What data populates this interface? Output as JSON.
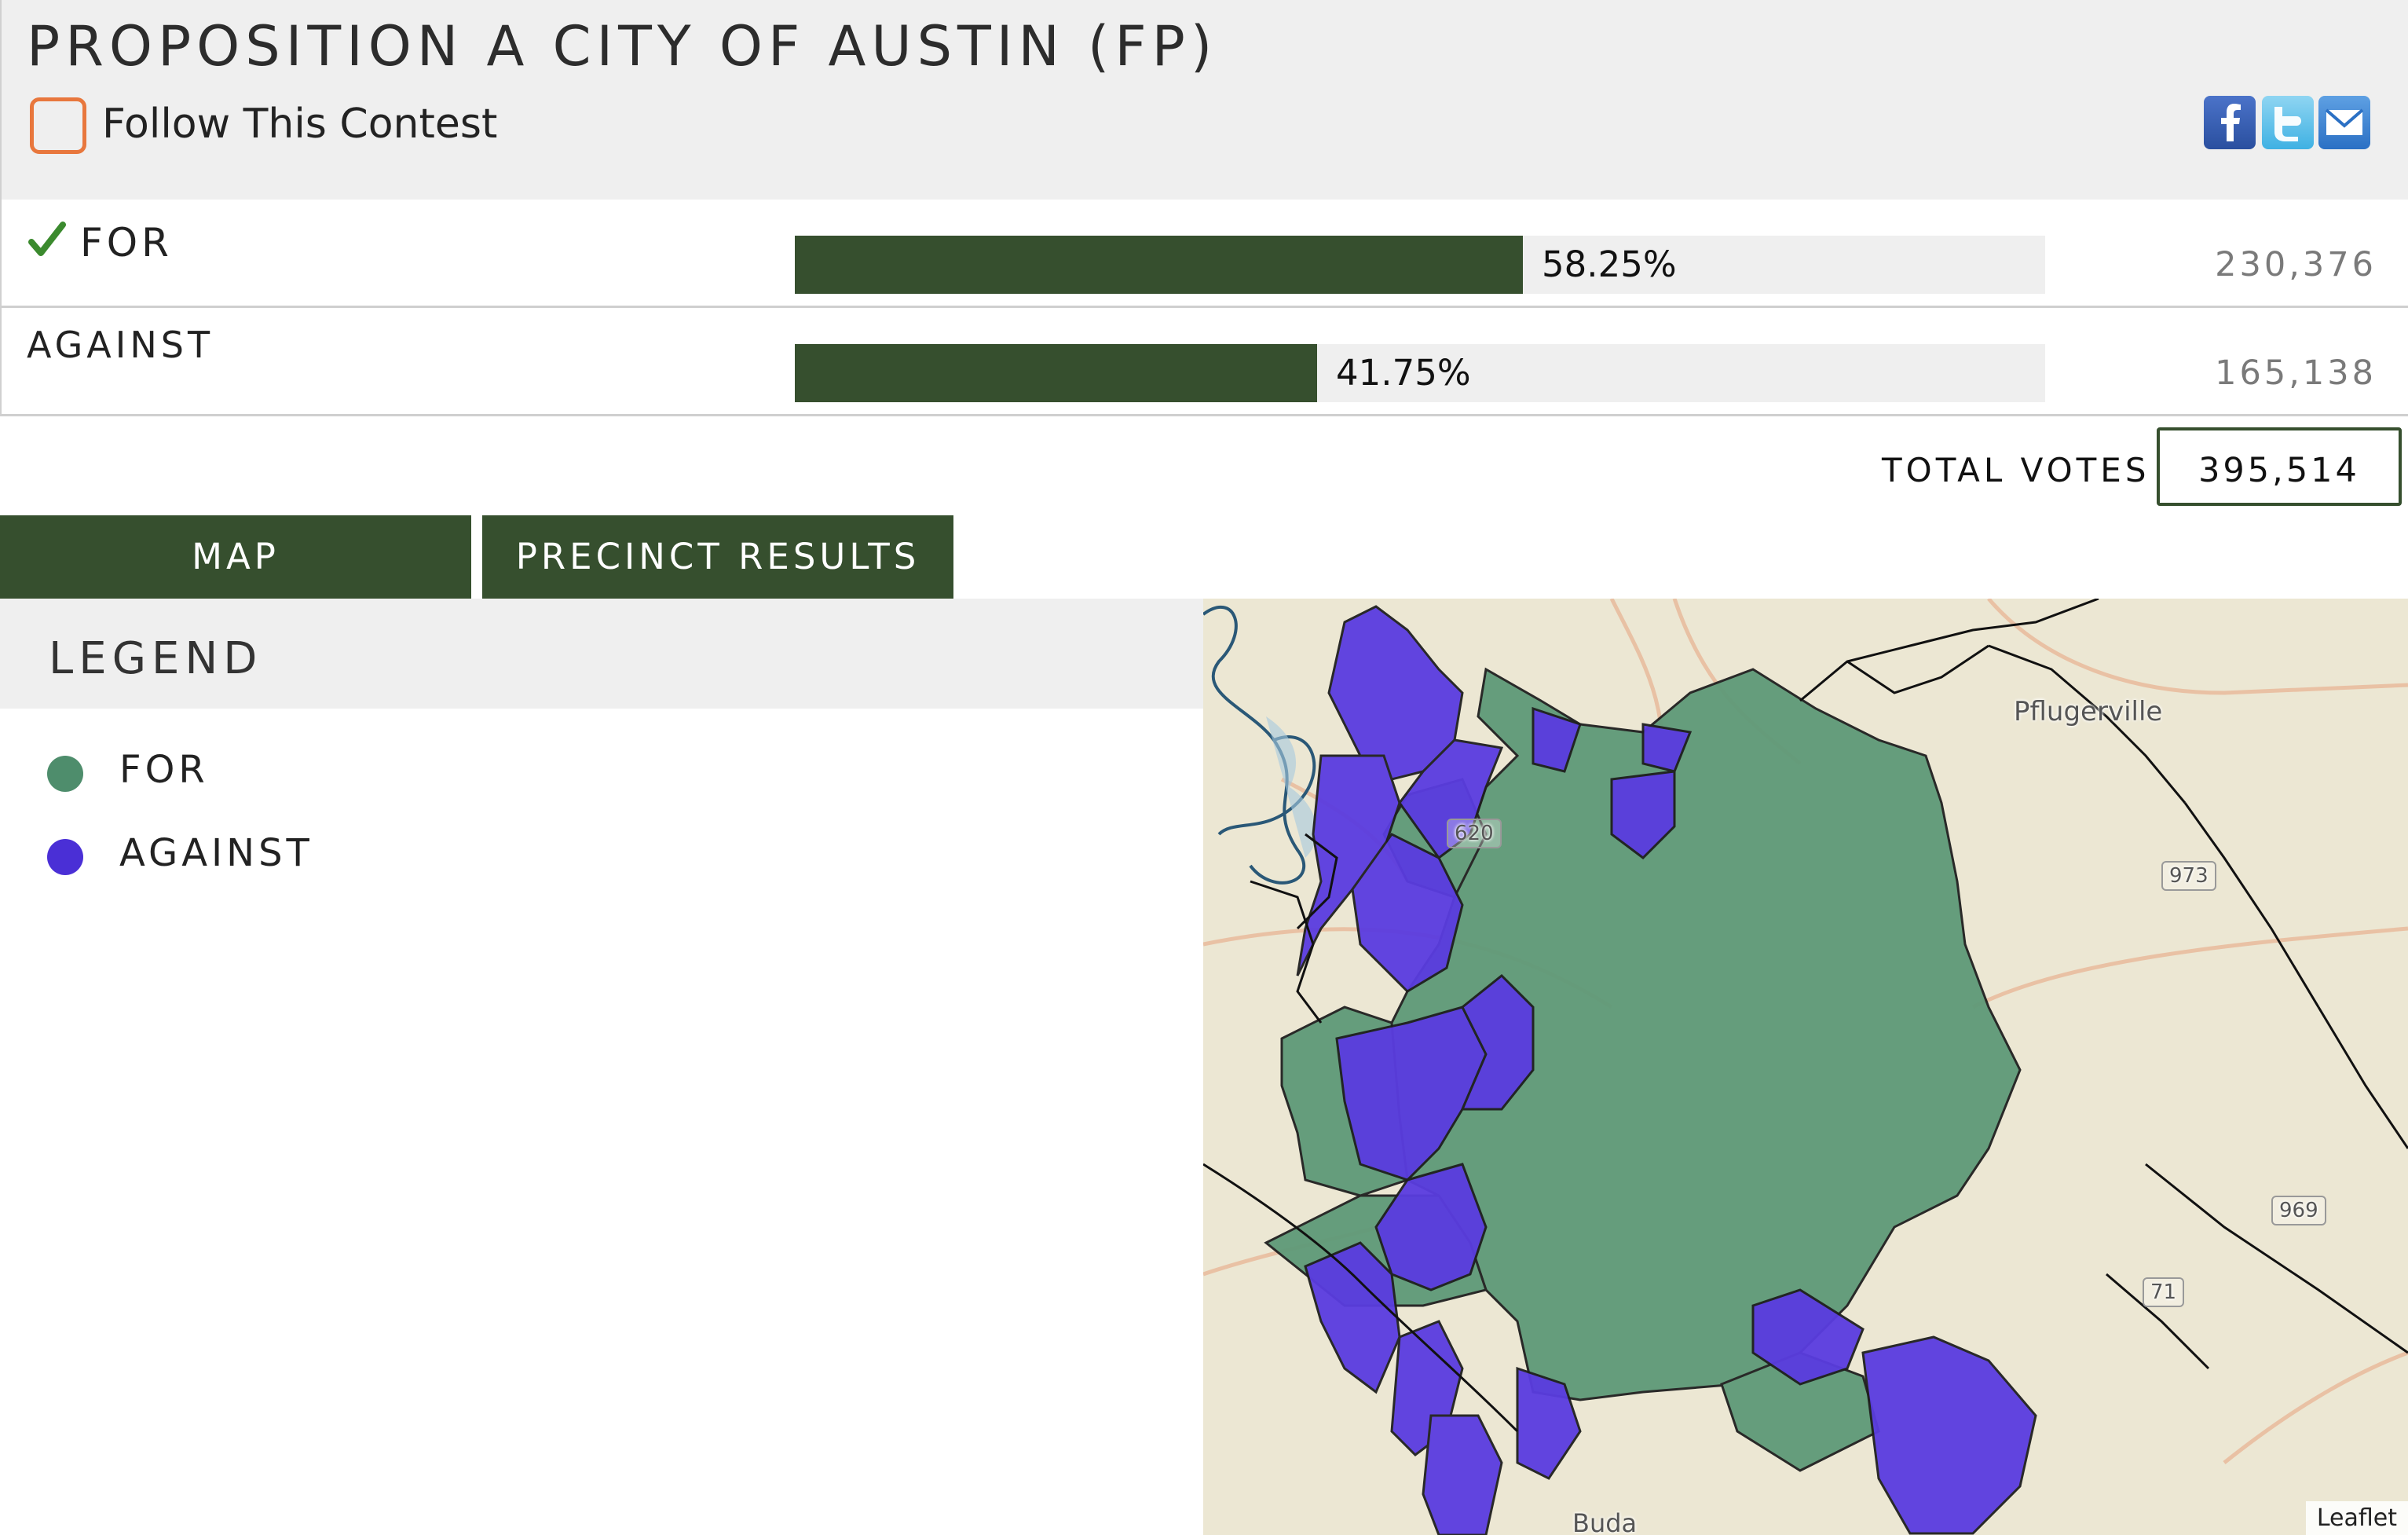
{
  "contest": {
    "title": "PROPOSITION A CITY OF AUSTIN (FP)",
    "follow_label": "Follow This Contest",
    "follow_checked": false
  },
  "share": {
    "icons": [
      "facebook-icon",
      "twitter-icon",
      "email-icon"
    ]
  },
  "results": [
    {
      "choice": "FOR",
      "winner": true,
      "percent": 58.25,
      "percent_label": "58.25%",
      "votes": "230,376"
    },
    {
      "choice": "AGAINST",
      "winner": false,
      "percent": 41.75,
      "percent_label": "41.75%",
      "votes": "165,138"
    }
  ],
  "totals": {
    "label": "TOTAL VOTES",
    "value": "395,514"
  },
  "tabs": [
    {
      "label": "MAP",
      "active": true
    },
    {
      "label": "PRECINCT RESULTS",
      "active": false
    }
  ],
  "legend": {
    "title": "LEGEND",
    "items": [
      {
        "label": "FOR",
        "color": "#4e8d6c"
      },
      {
        "label": "AGAINST",
        "color": "#4a2fd6"
      }
    ]
  },
  "map": {
    "labels": [
      "Pflugerville",
      "Buda",
      "973",
      "969",
      "71",
      "620"
    ],
    "attribution": "Leaflet",
    "colors": {
      "for": "#5e9a78",
      "against": "#5a3ce0",
      "bar": "#364f2e",
      "accent": "#e8773d"
    }
  }
}
